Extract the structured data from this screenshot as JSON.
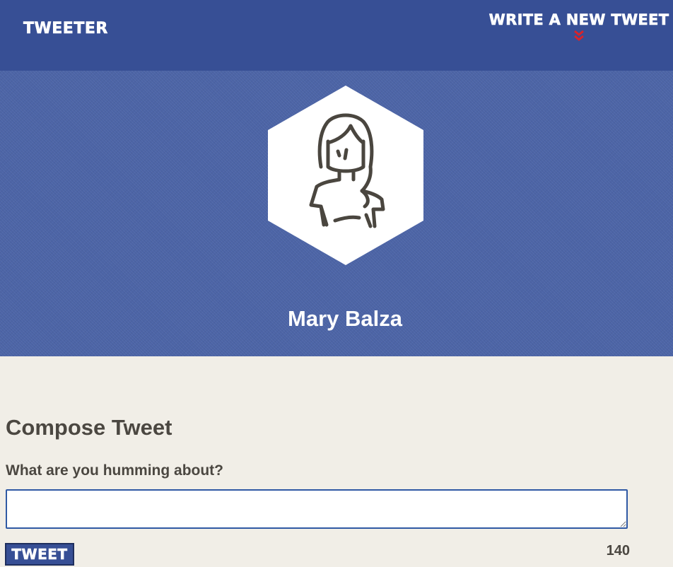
{
  "nav": {
    "brand": "TWEETER",
    "compose_link": "WRITE A NEW TWEET",
    "compose_link_icon": "double-chevron-down-icon"
  },
  "colors": {
    "nav_bg": "#374f95",
    "hero_bg": "#4c64a6",
    "page_bg": "#f1eee7",
    "accent_red": "#d8232a",
    "text_dark": "#4b4741"
  },
  "profile": {
    "name": "Mary Balza",
    "avatar_icon": "woman-avatar-icon"
  },
  "compose": {
    "title": "Compose Tweet",
    "label": "What are you humming about?",
    "text_value": "",
    "submit_label": "TWEET",
    "counter": "140"
  }
}
